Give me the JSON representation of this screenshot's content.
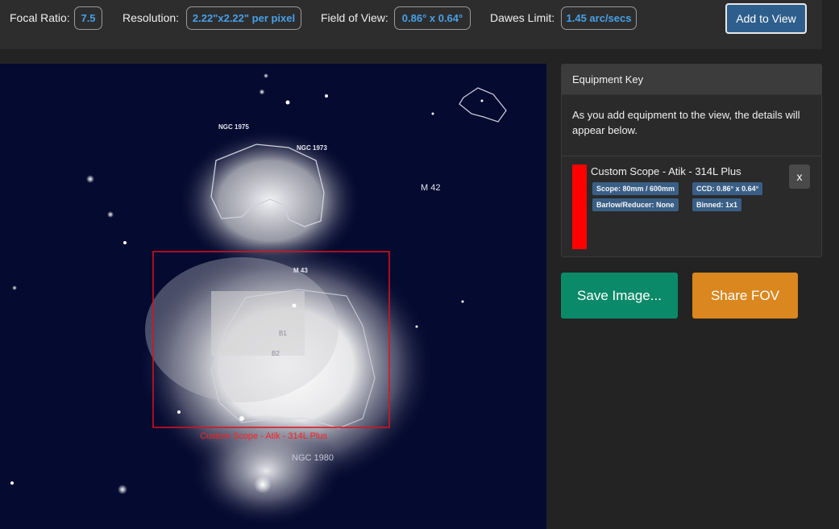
{
  "stats": {
    "focal_ratio_label": "Focal Ratio:",
    "focal_ratio_value": "7.5",
    "resolution_label": "Resolution:",
    "resolution_value": "2.22\"x2.22\" per pixel",
    "fov_label": "Field of View:",
    "fov_value": "0.86° x 0.64°",
    "dawes_label": "Dawes Limit:",
    "dawes_value": "1.45 arc/secs"
  },
  "toolbar": {
    "add_label": "Add to View"
  },
  "sky": {
    "labels": {
      "ngc1975": "NGC 1975",
      "ngc1973": "NGC 1973",
      "m42": "M 42",
      "m43": "M 43",
      "b1": "B1",
      "b2": "B2",
      "ngc1980": "NGC 1980"
    },
    "fov_label": "Custom Scope - Atik - 314L Plus",
    "fov_color": "#e0101a"
  },
  "equipment_key": {
    "header": "Equipment Key",
    "intro": "As you add equipment to the view, the details will appear below.",
    "item": {
      "color": "#ff0000",
      "title": "Custom Scope - Atik - 314L Plus",
      "scope": "Scope: 80mm / 600mm",
      "ccd": "CCD: 0.86° x 0.64°",
      "barlow": "Barlow/Reducer: None",
      "binned": "Binned: 1x1",
      "remove_label": "x"
    }
  },
  "actions": {
    "save_label": "Save Image...",
    "share_label": "Share FOV"
  }
}
